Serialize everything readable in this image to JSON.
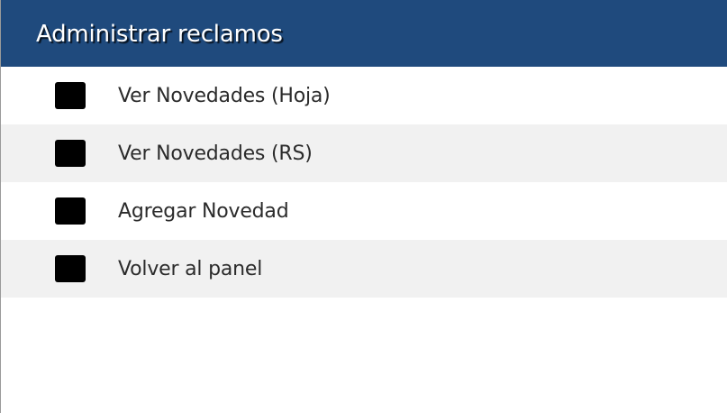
{
  "header": {
    "title": "Administrar reclamos",
    "background_color": "#1f4a7d"
  },
  "menu": {
    "items": [
      {
        "label": "Ver Novedades (Hoja)",
        "icon": "square-icon"
      },
      {
        "label": "Ver Novedades (RS)",
        "icon": "square-icon"
      },
      {
        "label": "Agregar Novedad",
        "icon": "square-icon"
      },
      {
        "label": "Volver al panel",
        "icon": "square-icon"
      }
    ]
  }
}
